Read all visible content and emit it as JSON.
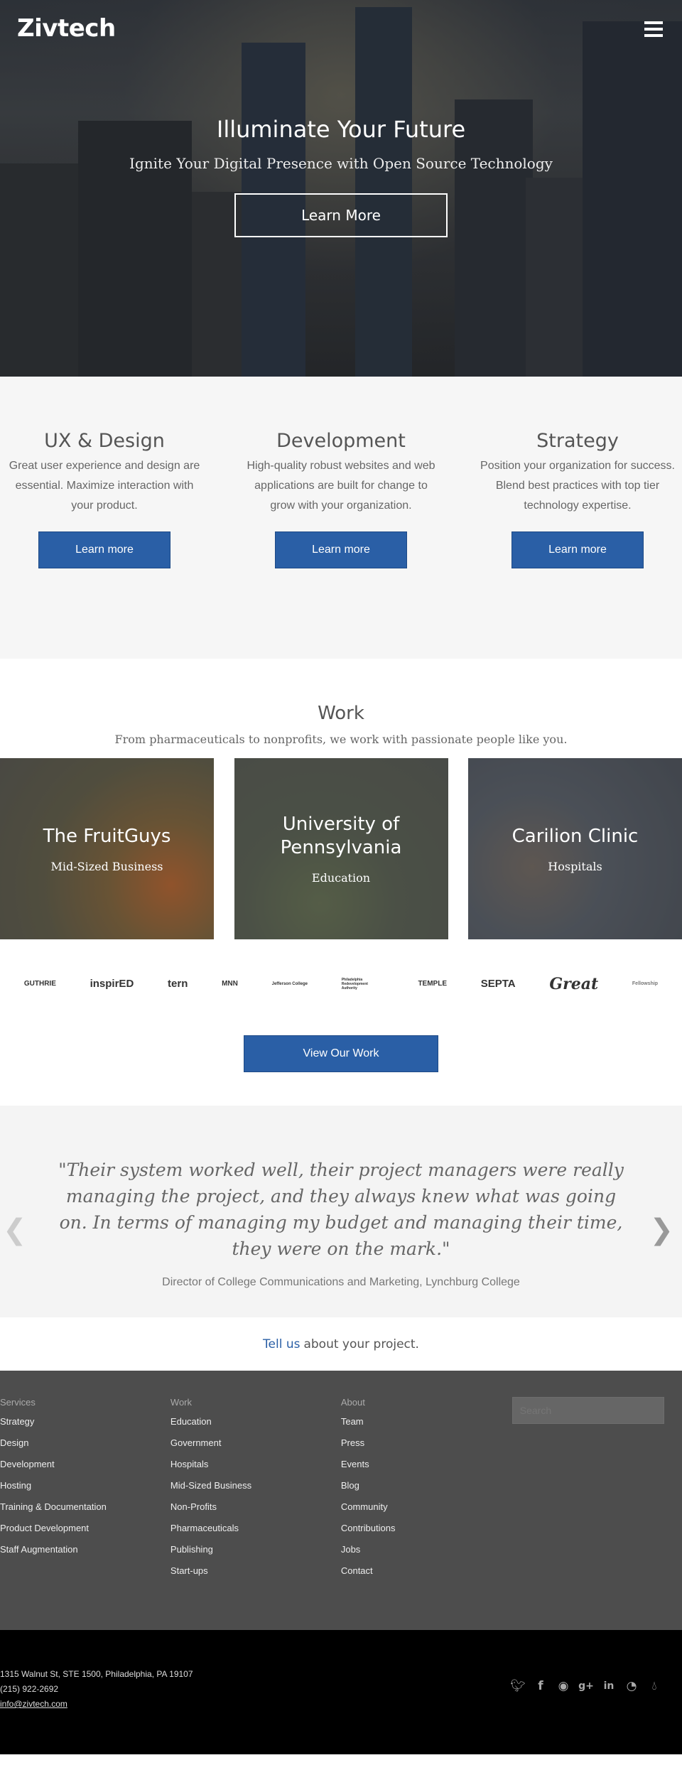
{
  "hero": {
    "logo": "Zivtech",
    "title": "Illuminate Your Future",
    "subtitle": "Ignite Your Digital Presence with Open Source Technology",
    "cta": "Learn More"
  },
  "services": [
    {
      "title": "UX & Design",
      "text": "Great user experience and design are essential. Maximize interaction with your product.",
      "button": "Learn more"
    },
    {
      "title": "Development",
      "text": "High-quality robust websites and web applications are built for change to grow with your organization.",
      "button": "Learn more"
    },
    {
      "title": "Strategy",
      "text": "Position your organization for success. Blend best practices with top tier technology expertise.",
      "button": "Learn more"
    }
  ],
  "work": {
    "title": "Work",
    "lead": "From pharmaceuticals to nonprofits, we work with passionate people like you.",
    "tiles": [
      {
        "title": "The FruitGuys",
        "category": "Mid-Sized Business"
      },
      {
        "title": "University of Pennsylvania",
        "category": "Education"
      },
      {
        "title": "Carilion Clinic",
        "category": "Hospitals"
      }
    ],
    "logos": [
      "GUTHRIE",
      "inspirED",
      "tern",
      "MNN",
      "Jefferson College",
      "Philadelphia Redevelopment Authority",
      "TEMPLE",
      "SEPTA",
      "Great",
      "Fellowship"
    ],
    "button": "View Our Work"
  },
  "testimonial": {
    "quote": "\"Their system worked well, their project managers were really managing the project, and they always knew what was going on. In terms of managing my budget and managing their time, they were on the mark.\"",
    "author": "Director of College Communications and Marketing, Lynchburg College"
  },
  "contact": {
    "link": "Tell us",
    "text": "about your project."
  },
  "footer": {
    "columns": [
      {
        "heading": "Services",
        "links": [
          "Strategy",
          "Design",
          "Development",
          "Hosting",
          "Training & Documentation",
          "Product Development",
          "Staff Augmentation"
        ]
      },
      {
        "heading": "Work",
        "links": [
          "Education",
          "Government",
          "Hospitals",
          "Mid-Sized Business",
          "Non-Profits",
          "Pharmaceuticals",
          "Publishing",
          "Start-ups"
        ]
      },
      {
        "heading": "About",
        "links": [
          "Team",
          "Press",
          "Events",
          "Blog",
          "Community",
          "Contributions",
          "Jobs",
          "Contact"
        ]
      }
    ],
    "search_placeholder": "Search",
    "address": "1315 Walnut St, STE 1500, Philadelphia, PA 19107",
    "phone": "(215) 922-2692",
    "email": "info@zivtech.com",
    "social": [
      "twitter-icon",
      "facebook-icon",
      "github-icon",
      "google-plus-icon",
      "linkedin-icon",
      "rss-icon",
      "drupal-icon"
    ]
  }
}
